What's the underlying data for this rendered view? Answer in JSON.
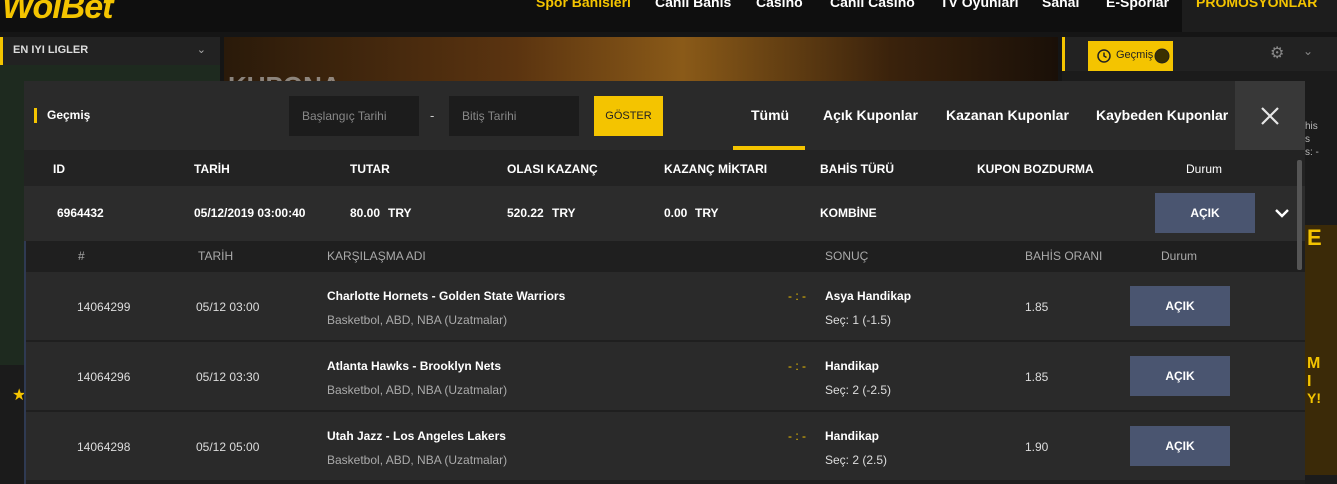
{
  "brand": {
    "logo": "WolBet",
    "accent": "#f4c400"
  },
  "nav": {
    "items": [
      "Spor Bahisleri",
      "Canlı Bahis",
      "Casino",
      "Canlı Casino",
      "TV Oyunları",
      "Sanal",
      "E-Sporlar"
    ],
    "promo": "PROMOSYONLAR"
  },
  "leftcol": {
    "header": "EN IYI LIGLER"
  },
  "banner": {
    "text": "KUPONA"
  },
  "rightcol": {
    "history_label": "Geçmiş"
  },
  "sidetext": {
    "line1": "his",
    "line2": "s",
    "line3": "s: -"
  },
  "sidepromo": {
    "l1": "E",
    "l2": "M",
    "l3": "I",
    "l4": "Y!"
  },
  "modal": {
    "title": "Geçmiş",
    "start_placeholder": "Başlangıç Tarihi",
    "end_placeholder": "Bitiş Tarihi",
    "dash": "-",
    "show_label": "GÖSTER",
    "tabs": [
      "Tümü",
      "Açık Kuponlar",
      "Kazanan Kuponlar",
      "Kaybeden Kuponlar"
    ],
    "columns": [
      "ID",
      "TARİH",
      "TUTAR",
      "OLASI KAZANÇ",
      "KAZANÇ MİKTARI",
      "BAHİS TÜRÜ",
      "KUPON BOZDURMA",
      "Durum"
    ],
    "coupon": {
      "id": "6964432",
      "date": "05/12/2019 03:00:40",
      "amount": "80.00",
      "amount_cur": "TRY",
      "possible_win": "520.22",
      "possible_cur": "TRY",
      "win_amount": "0.00",
      "win_cur": "TRY",
      "bet_type": "KOMBİNE",
      "status": "AÇIK"
    },
    "detail_columns": [
      "#",
      "TARİH",
      "KARŞILAŞMA ADI",
      "SONUÇ",
      "BAHİS ORANI",
      "Durum"
    ],
    "matches": [
      {
        "no": "14064299",
        "date": "05/12 03:00",
        "name": "Charlotte Hornets - Golden State Warriors",
        "league": "Basketbol, ABD, NBA (Uzatmalar)",
        "score": "- : -",
        "market": "Asya Handikap",
        "pick": "Seç:  1 (-1.5)",
        "odds": "1.85",
        "status": "AÇIK"
      },
      {
        "no": "14064296",
        "date": "05/12 03:30",
        "name": "Atlanta Hawks - Brooklyn Nets",
        "league": "Basketbol, ABD, NBA (Uzatmalar)",
        "score": "- : -",
        "market": "Handikap",
        "pick": "Seç:  2 (-2.5)",
        "odds": "1.85",
        "status": "AÇIK"
      },
      {
        "no": "14064298",
        "date": "05/12 05:00",
        "name": "Utah Jazz - Los Angeles Lakers",
        "league": "Basketbol, ABD, NBA (Uzatmalar)",
        "score": "- : -",
        "market": "Handikap",
        "pick": "Seç:  2 (2.5)",
        "odds": "1.90",
        "status": "AÇIK"
      }
    ]
  }
}
